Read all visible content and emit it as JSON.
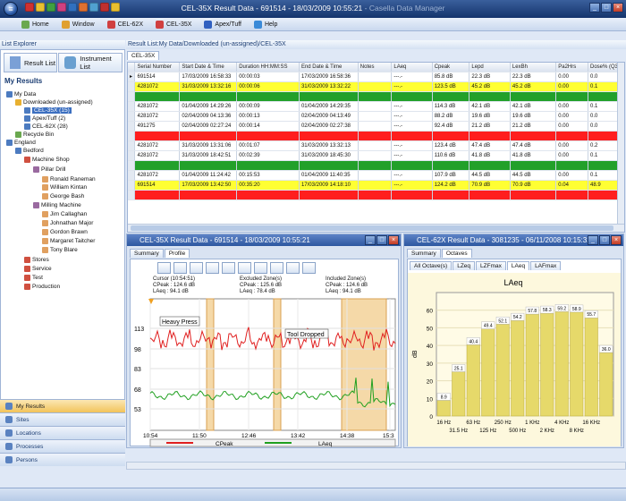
{
  "app": {
    "title": "CEL-35X Result Data - 691514 - 18/03/2009 10:55:21",
    "app_name": " - Casella Data Manager"
  },
  "menu": [
    {
      "label": "Home",
      "color": "#6aa84f"
    },
    {
      "label": "Window",
      "color": "#e0a030"
    },
    {
      "label": "CEL-62X",
      "color": "#d04040"
    },
    {
      "label": "CEL-35X",
      "color": "#d04040"
    },
    {
      "label": "Apex/Tuff",
      "color": "#3060c0"
    },
    {
      "label": "Help",
      "color": "#3a8ad8"
    }
  ],
  "explorer": {
    "header": "List Explorer",
    "result_list": "Result List",
    "instrument_list": "Instrument List",
    "my_results": "My Results"
  },
  "tree": [
    "My Data",
    "Downloaded (un-assigned)",
    "CEL-35X (15)",
    "Apex/Tuff (2)",
    "CEL-62X (28)",
    "Recycle Bin",
    "England",
    "Bedford",
    "Machine Shop",
    "Pillar Drill",
    "Ronald Raneman",
    "William Kintan",
    "George Bash",
    "Milling Machine",
    "Jim Callaghan",
    "Johnathan Major",
    "Gordon Brawn",
    "Margaret Taitcher",
    "Tony Blare",
    "Stores",
    "Service",
    "Test",
    "Production"
  ],
  "nav": [
    "My Results",
    "Sites",
    "Locations",
    "Processes",
    "Persons"
  ],
  "resultlist": {
    "path": "Result List:My Data/Downloaded (un-assigned)/CEL-35X",
    "tab": "CEL-35X",
    "columns": [
      "Serial Number",
      "Start Date & Time",
      "Duration HH:MM:SS",
      "End Date & Time",
      "Notes",
      "LAeq",
      "Cpeak",
      "Lepd",
      "LexBh",
      "Pa2Hrs",
      "Dose% (Q3"
    ],
    "rows": [
      {
        "c": "white",
        "v": [
          "691514",
          "17/03/2009 16:58:33",
          "00:00:03",
          "17/03/2009 16:58:36",
          "",
          "---.-",
          "85.8 dB",
          "22.3 dB",
          "22.3 dB",
          "0.00",
          "0.0"
        ]
      },
      {
        "c": "yellow",
        "v": [
          "4281072",
          "31/03/2009 13:32:16",
          "00:00:06",
          "31/03/2009 13:32:22",
          "",
          "---.-",
          "123.5 dB",
          "45.2 dB",
          "45.2 dB",
          "0.00",
          "0.1"
        ]
      },
      {
        "c": "green",
        "v": [
          "",
          "",
          "",
          "",
          "",
          "",
          "",
          "",
          "",
          "",
          ""
        ]
      },
      {
        "c": "white",
        "v": [
          "4281072",
          "01/04/2009 14:29:26",
          "00:00:09",
          "01/04/2009 14:29:35",
          "",
          "---.-",
          "114.3 dB",
          "42.1 dB",
          "42.1 dB",
          "0.00",
          "0.1"
        ]
      },
      {
        "c": "white",
        "v": [
          "4281072",
          "02/04/2009 04:13:36",
          "00:00:13",
          "02/04/2009 04:13:49",
          "",
          "---.-",
          "88.2 dB",
          "19.6 dB",
          "19.6 dB",
          "0.00",
          "0.0"
        ]
      },
      {
        "c": "white",
        "v": [
          "491275",
          "02/04/2009 02:27:24",
          "00:00:14",
          "02/04/2009 02:27:38",
          "",
          "---.-",
          "92.4 dB",
          "21.2 dB",
          "21.2 dB",
          "0.00",
          "0.0"
        ]
      },
      {
        "c": "red",
        "v": [
          "",
          "",
          "",
          "",
          "",
          "",
          "",
          "",
          "",
          "",
          ""
        ]
      },
      {
        "c": "white",
        "v": [
          "4281072",
          "31/03/2009 13:31:06",
          "00:01:07",
          "31/03/2009 13:32:13",
          "",
          "---.-",
          "123.4 dB",
          "47.4 dB",
          "47.4 dB",
          "0.00",
          "0.2"
        ]
      },
      {
        "c": "white",
        "v": [
          "4281072",
          "31/03/2009 18:42:51",
          "00:02:39",
          "31/03/2009 18:45:30",
          "",
          "---.-",
          "110.6 dB",
          "41.8 dB",
          "41.8 dB",
          "0.00",
          "0.1"
        ]
      },
      {
        "c": "green",
        "v": [
          "",
          "",
          "",
          "",
          "",
          "",
          "",
          "",
          "",
          "",
          ""
        ]
      },
      {
        "c": "white",
        "v": [
          "4281072",
          "01/04/2009 11:24:42",
          "00:15:53",
          "01/04/2009 11:40:35",
          "",
          "---.-",
          "107.9 dB",
          "44.5 dB",
          "44.5 dB",
          "0.00",
          "0.1"
        ]
      },
      {
        "c": "yellow",
        "v": [
          "691514",
          "17/03/2009 13:42:50",
          "00:35:20",
          "17/03/2009 14:18:10",
          "",
          "---.-",
          "124.2 dB",
          "70.9 dB",
          "70.9 dB",
          "0.04",
          "48.9"
        ]
      },
      {
        "c": "red",
        "v": [
          "",
          "",
          "",
          "",
          "",
          "",
          "",
          "",
          "",
          "",
          ""
        ]
      }
    ]
  },
  "profile_window": {
    "title": "CEL-35X Result Data - 691514 - 18/03/2009 10:55:21",
    "tabs": [
      "Summary",
      "Profile"
    ],
    "cursor": [
      "Cursor (10:54:51)",
      "CPeak : 124.6 dB",
      "LAeq : 94.1 dB"
    ],
    "excluded": [
      "Excluded Zone(s)",
      "CPeak : 125.6 dB",
      "LAeq : 78.4 dB"
    ],
    "included": [
      "Included Zone(s)",
      "CPeak : 124.6 dB",
      "LAeq : 94.1 dB"
    ],
    "notes": [
      "Heavy Press",
      "Tool Dropped"
    ],
    "yticks": [
      "113",
      "98",
      "83",
      "68",
      "53"
    ],
    "xticks": [
      "10:54",
      "11:50",
      "12:46",
      "13:42",
      "14:38",
      "15:3"
    ],
    "legend": [
      "CPeak",
      "LAeq"
    ],
    "colors": {
      "cpeak": "#e02020",
      "laeq": "#20a020"
    }
  },
  "octave_window": {
    "title": "CEL-62X Result Data - 3081235 - 06/11/2008 10:15:32",
    "tabs": [
      "Summary",
      "Octaves"
    ],
    "subtabs": [
      "All Octave(s)",
      "LZeq",
      "LZFmax",
      "LAeq",
      "LAFmax"
    ]
  },
  "chart_data": {
    "type": "bar",
    "title": "LAeq",
    "ylabel": "dB",
    "ylim": [
      0,
      70
    ],
    "yticks": [
      "0",
      "10",
      "20",
      "30",
      "40",
      "50",
      "60"
    ],
    "xticks_top": [
      "16 Hz",
      "63 Hz",
      "250 Hz",
      "1 KHz",
      "4 KHz",
      "16 KHz"
    ],
    "xticks_bottom": [
      "31.5 Hz",
      "125 Hz",
      "500 Hz",
      "2 KHz",
      "8 KHz"
    ],
    "values": [
      8.9,
      25.1,
      40.4,
      49.4,
      52.1,
      54.2,
      57.8,
      58.3,
      59.2,
      58.9,
      55.7,
      36.0
    ],
    "labels": [
      "8.9",
      "25.1",
      "40.4",
      "49.4",
      "52.1",
      "54.2",
      "57.8",
      "58.3",
      "59.2",
      "58.9",
      "55.7",
      "36.0"
    ],
    "color": "#e6d96a"
  }
}
